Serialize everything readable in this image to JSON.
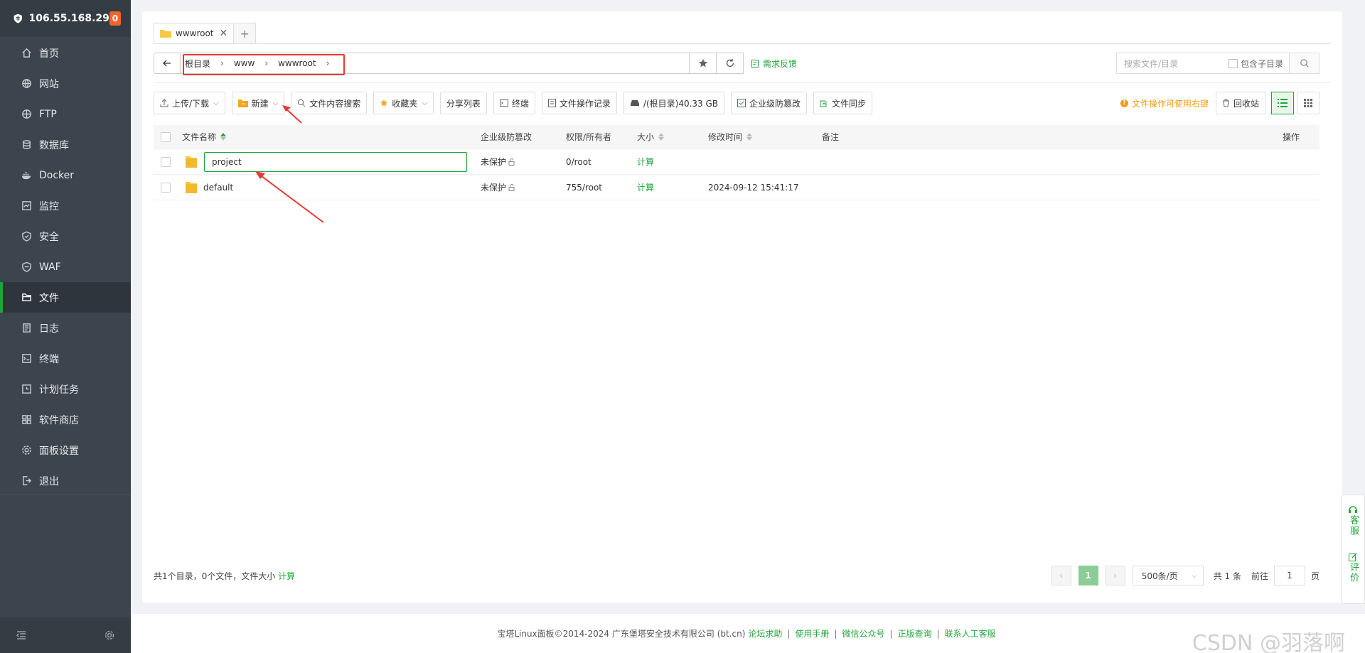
{
  "sidebar": {
    "ip": "106.55.168.29",
    "badge": "0",
    "items": [
      {
        "label": "首页",
        "icon": "home-icon"
      },
      {
        "label": "网站",
        "icon": "globe-icon"
      },
      {
        "label": "FTP",
        "icon": "ftp-icon"
      },
      {
        "label": "数据库",
        "icon": "database-icon"
      },
      {
        "label": "Docker",
        "icon": "docker-icon"
      },
      {
        "label": "监控",
        "icon": "monitor-icon"
      },
      {
        "label": "安全",
        "icon": "shield-icon"
      },
      {
        "label": "WAF",
        "icon": "waf-icon"
      },
      {
        "label": "文件",
        "icon": "folder-icon",
        "active": true
      },
      {
        "label": "日志",
        "icon": "log-icon"
      },
      {
        "label": "终端",
        "icon": "terminal-icon"
      },
      {
        "label": "计划任务",
        "icon": "clock-icon"
      },
      {
        "label": "软件商店",
        "icon": "apps-icon"
      },
      {
        "label": "面板设置",
        "icon": "settings-icon"
      },
      {
        "label": "退出",
        "icon": "logout-icon"
      }
    ]
  },
  "tabs": {
    "current": "wwwroot"
  },
  "path": {
    "crumbs": [
      "根目录",
      "www",
      "wwwroot"
    ],
    "feedback": "需求反馈"
  },
  "search": {
    "placeholder": "搜索文件/目录",
    "include_sub": "包含子目录"
  },
  "toolbar": {
    "upload": "上传/下载",
    "new": "新建",
    "content_search": "文件内容搜索",
    "favorites": "收藏夹",
    "share_list": "分享列表",
    "terminal": "终端",
    "op_log": "文件操作记录",
    "disk": "/(根目录)40.33 GB",
    "tamper": "企业级防篡改",
    "sync": "文件同步",
    "tip": "文件操作可使用右键",
    "recycle": "回收站"
  },
  "table": {
    "headers": {
      "name": "文件名称",
      "protect": "企业级防篡改",
      "perm": "权限/所有者",
      "size": "大小",
      "mtime": "修改时间",
      "note": "备注",
      "ops": "操作"
    },
    "rows": [
      {
        "name": "project",
        "protect": "未保护",
        "perm": "0/root",
        "size": "计算",
        "mtime": "",
        "editing": true
      },
      {
        "name": "default",
        "protect": "未保护",
        "perm": "755/root",
        "size": "计算",
        "mtime": "2024-09-12 15:41:17"
      }
    ]
  },
  "footer": {
    "summary": "共1个目录，0个文件，文件大小",
    "calc": "计算",
    "page": "1",
    "page_size": "500条/页",
    "total": "共 1 条",
    "goto": "前往",
    "goto_value": "1",
    "page_unit": "页"
  },
  "copyright": {
    "text": "宝塔Linux面板©2014-2024 广东堡塔安全技术有限公司 (bt.cn)",
    "links": [
      "论坛求助",
      "使用手册",
      "微信公众号",
      "正版查询",
      "联系人工客服"
    ]
  },
  "floatbar": {
    "service": "客服",
    "review": "评价"
  },
  "watermark": "CSDN @羽落啊",
  "colors": {
    "accent": "#20a53a",
    "sidebar": "#3c444d",
    "highlight": "#e53935"
  }
}
